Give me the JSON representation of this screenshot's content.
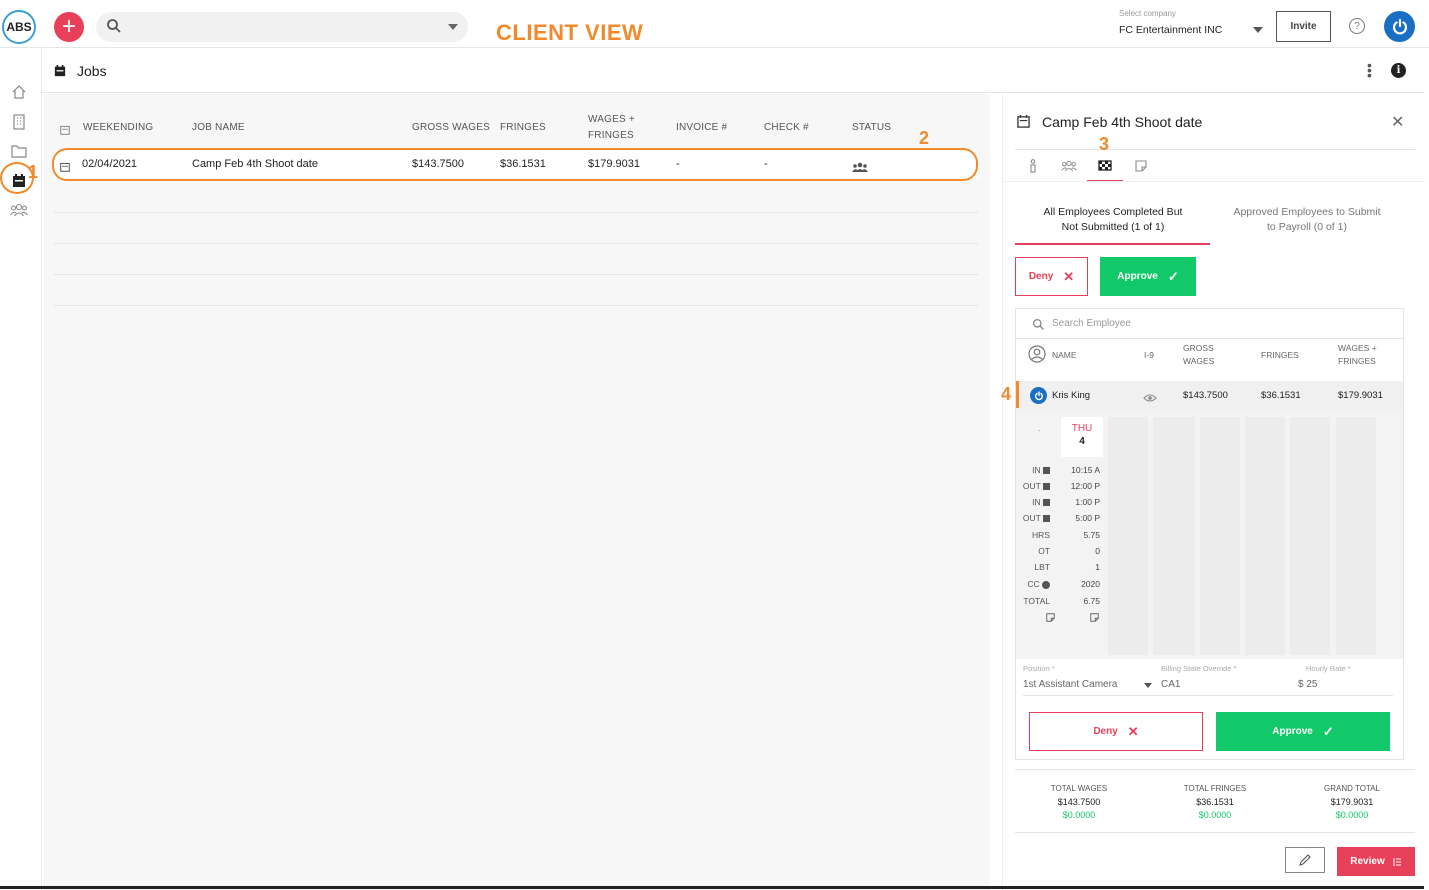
{
  "header": {
    "logo_text": "ABS",
    "annotation_title": "CLIENT VIEW",
    "company_label": "Select company",
    "company_value": "FC Entertainment INC",
    "invite_label": "Invite",
    "help_glyph": "?"
  },
  "annotations": {
    "n1": "1",
    "n2": "2",
    "n3": "3",
    "n4": "4"
  },
  "page": {
    "title": "Jobs"
  },
  "jobs_table": {
    "headers": {
      "weekending": "WEEKENDING",
      "job_name": "JOB NAME",
      "gross_wages": "GROSS WAGES",
      "fringes": "FRINGES",
      "wages_fringes_1": "WAGES +",
      "wages_fringes_2": "FRINGES",
      "invoice": "INVOICE #",
      "check": "CHECK #",
      "status": "STATUS"
    },
    "rows": [
      {
        "weekending": "02/04/2021",
        "job_name": "Camp Feb 4th Shoot date",
        "gross_wages": "$143.7500",
        "fringes": "$36.1531",
        "wages_fringes": "$179.9031",
        "invoice": "-",
        "check": "-"
      }
    ]
  },
  "panel": {
    "title": "Camp Feb 4th Shoot date",
    "subtabs": {
      "completed_1": "All Employees Completed But",
      "completed_2": "Not Submitted (1 of 1)",
      "approved_1": "Approved Employees to Submit",
      "approved_2": "to Payroll (0 of 1)"
    },
    "deny_label": "Deny",
    "approve_label": "Approve",
    "search_placeholder": "Search Employee",
    "emp_headers": {
      "name": "NAME",
      "i9": "I-9",
      "gross_1": "GROSS",
      "gross_2": "WAGES",
      "fringes": "FRINGES",
      "wf_1": "WAGES +",
      "wf_2": "FRINGES"
    },
    "employee": {
      "name": "Kris King",
      "gross": "$143.7500",
      "fringes": "$36.1531",
      "wages_fringes": "$179.9031"
    },
    "timecard": {
      "dot": ".",
      "day": "THU",
      "date": "4",
      "rows": [
        {
          "label": "IN",
          "value": "10:15 A"
        },
        {
          "label": "OUT",
          "value": "12:00 P"
        },
        {
          "label": "IN",
          "value": "1:00 P"
        },
        {
          "label": "OUT",
          "value": "5:00 P"
        },
        {
          "label": "HRS",
          "value": "5.75"
        },
        {
          "label": "OT",
          "value": "0"
        },
        {
          "label": "LBT",
          "value": "1"
        },
        {
          "label": "CC",
          "value": "2020"
        },
        {
          "label": "TOTAL",
          "value": "6.75"
        }
      ]
    },
    "fields": {
      "position_label": "Position *",
      "position_value": "1st Assistant Camera",
      "billing_label": "Billing State Override *",
      "billing_value": "CA1",
      "rate_label": "Hourly Rate *",
      "rate_value": "$ 25"
    },
    "totals": {
      "wages_label": "TOTAL WAGES",
      "wages_value": "$143.7500",
      "wages_green": "$0.0000",
      "fringes_label": "TOTAL FRINGES",
      "fringes_value": "$36.1531",
      "fringes_green": "$0.0000",
      "grand_label": "GRAND TOTAL",
      "grand_value": "$179.9031",
      "grand_green": "$0.0000"
    },
    "review_label": "Review"
  },
  "colors": {
    "accent_red": "#e8405a",
    "approve_green": "#12c96a",
    "annotation_orange": "#f08a2a",
    "avatar_blue": "#1a6fc4"
  }
}
